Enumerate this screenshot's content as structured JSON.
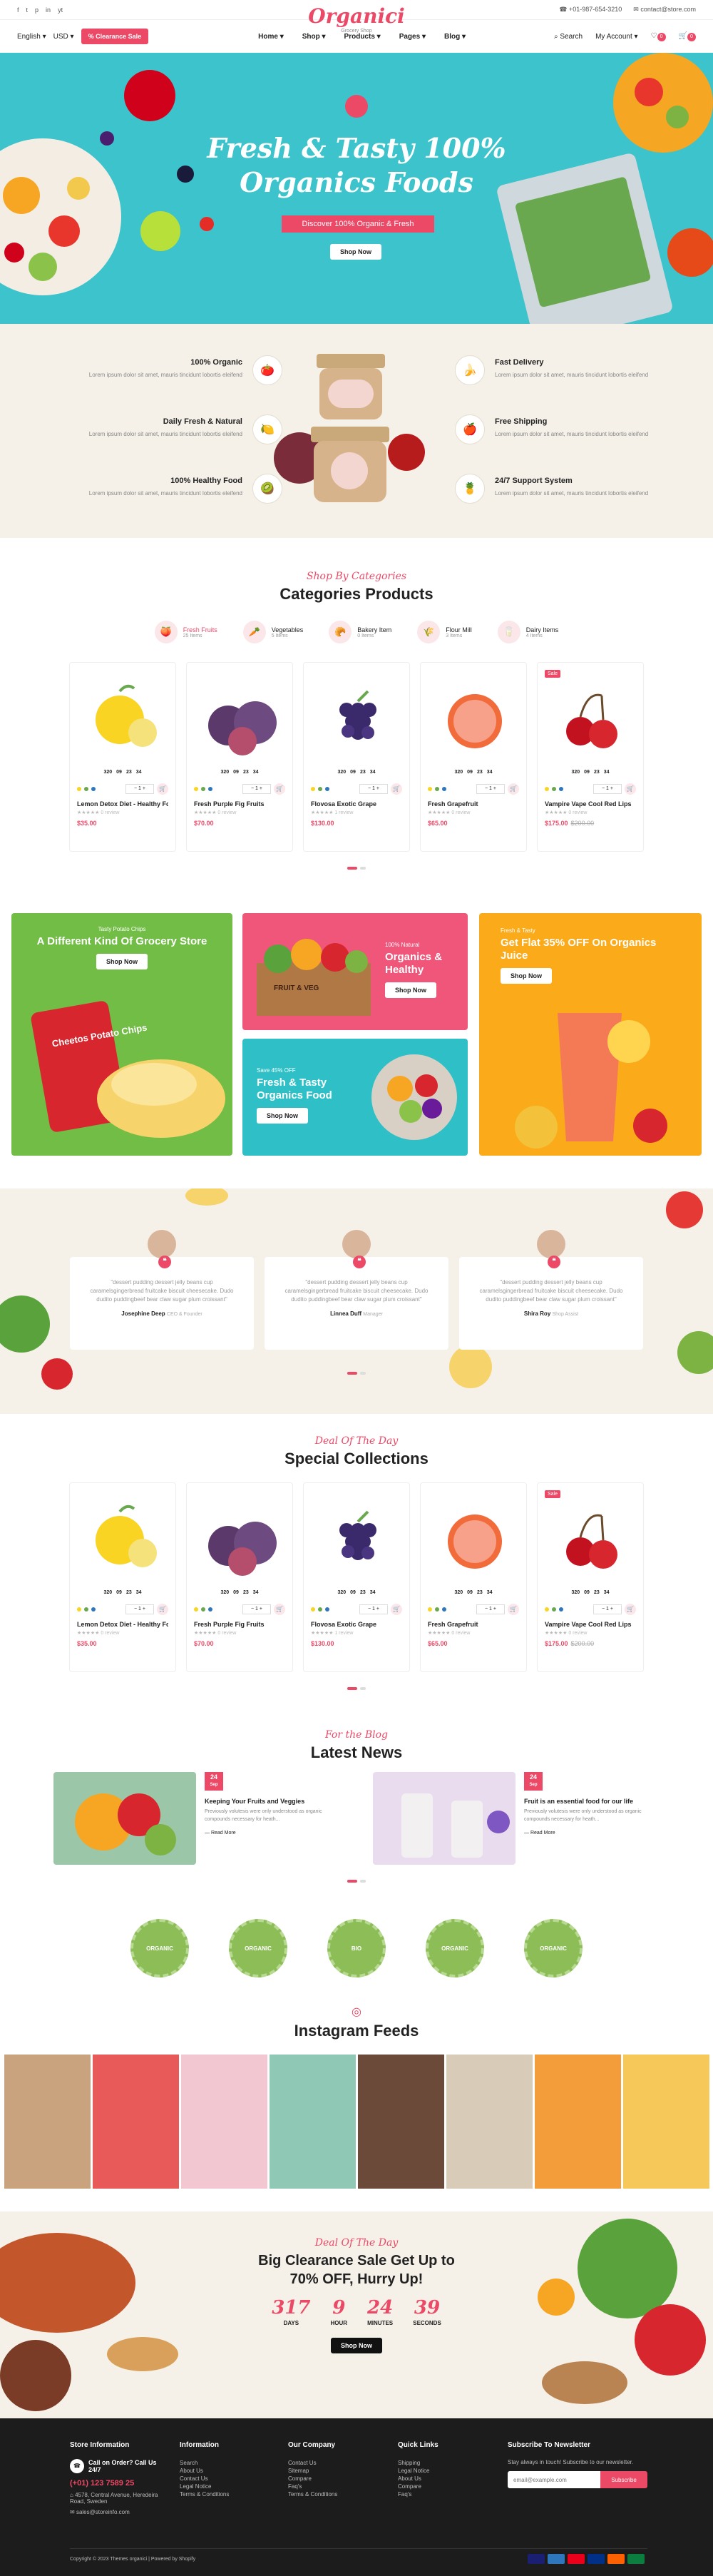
{
  "topbar": {
    "social": [
      "f",
      "t",
      "p",
      "in",
      "yt"
    ],
    "phone": "+01-987-654-3210",
    "email": "contact@store.com"
  },
  "logo": {
    "name": "Organici",
    "tagline": "Grocery Shop"
  },
  "nav": {
    "language": "English",
    "currency": "USD",
    "clearance": "Clearance Sale",
    "menu": [
      "Home",
      "Shop",
      "Products",
      "Pages",
      "Blog"
    ],
    "search": "Search",
    "account": "My Account",
    "wishlist_count": "0",
    "cart_count": "0"
  },
  "hero": {
    "title_line1": "Fresh & Tasty 100%",
    "title_line2": "Organics Foods",
    "subtitle": "Discover 100% Organic & Fresh",
    "button": "Shop Now"
  },
  "features": [
    {
      "title": "100% Organic",
      "text": "Lorem ipsum dolor sit amet, mauris tincidunt lobortis eleifend"
    },
    {
      "title": "Daily Fresh & Natural",
      "text": "Lorem ipsum dolor sit amet, mauris tincidunt lobortis eleifend"
    },
    {
      "title": "100% Healthy Food",
      "text": "Lorem ipsum dolor sit amet, mauris tincidunt lobortis eleifend"
    },
    {
      "title": "Fast Delivery",
      "text": "Lorem ipsum dolor sit amet, mauris tincidunt lobortis eleifend"
    },
    {
      "title": "Free Shipping",
      "text": "Lorem ipsum dolor sit amet, mauris tincidunt lobortis eleifend"
    },
    {
      "title": "24/7 Support System",
      "text": "Lorem ipsum dolor sit amet, mauris tincidunt lobortis eleifend"
    }
  ],
  "categories_section": {
    "kicker": "Shop By Categories",
    "title": "Categories Products",
    "categories": [
      {
        "name": "Fresh Fruits",
        "count": "25 Items",
        "icon": "fruit-icon"
      },
      {
        "name": "Vegetables",
        "count": "5 Items",
        "icon": "vegetable-icon"
      },
      {
        "name": "Bakery Item",
        "count": "0 Items",
        "icon": "bread-icon"
      },
      {
        "name": "Flour Mill",
        "count": "3 Items",
        "icon": "flour-icon"
      },
      {
        "name": "Dairy Items",
        "count": "4 Items",
        "icon": "dairy-icon"
      }
    ]
  },
  "products": [
    {
      "name": "Lemon Detox Diet - Healthy Fo...",
      "price": "$35.00",
      "old_price": "",
      "reviews": "0 review",
      "timer": [
        "320",
        "09",
        "23",
        "34"
      ],
      "sale": ""
    },
    {
      "name": "Fresh Purple Fig Fruits",
      "price": "$70.00",
      "old_price": "",
      "reviews": "0 review",
      "timer": [
        "320",
        "09",
        "23",
        "34"
      ],
      "sale": ""
    },
    {
      "name": "Flovosa Exotic Grape",
      "price": "$130.00",
      "old_price": "",
      "reviews": "1 review",
      "timer": [
        "320",
        "09",
        "23",
        "34"
      ],
      "sale": ""
    },
    {
      "name": "Fresh Grapefruit",
      "price": "$65.00",
      "old_price": "",
      "reviews": "0 review",
      "timer": [
        "320",
        "09",
        "23",
        "34"
      ],
      "sale": ""
    },
    {
      "name": "Vampire Vape Cool Red Lips",
      "price": "$175.00",
      "old_price": "$200.00",
      "reviews": "0 review",
      "timer": [
        "320",
        "09",
        "23",
        "34"
      ],
      "sale": "Sale"
    }
  ],
  "banners": {
    "chips": {
      "kicker": "Tasty Potato Chips",
      "title": "A Different Kind Of Grocery Store",
      "button": "Shop Now",
      "product": "Cheetos Potato Chips"
    },
    "healthy": {
      "kicker": "100% Natural",
      "title": "Organics & Healthy",
      "button": "Shop Now",
      "crate": "FRUIT & VEG"
    },
    "juice": {
      "kicker": "Fresh & Tasty",
      "title": "Get Flat 35% OFF On Organics Juice",
      "button": "Shop Now"
    },
    "tasty": {
      "kicker": "Save 45% OFF",
      "title": "Fresh & Tasty Organics Food",
      "button": "Shop Now"
    }
  },
  "testimonials": [
    {
      "text": "\"dessert pudding dessert jelly beans cup caramelsgingerbread fruitcake biscuit cheesecake. Dudo dudito puddingbeef bear claw sugar plum croissant\"",
      "name": "Josephine Deep",
      "role": "CEO & Founder"
    },
    {
      "text": "\"dessert pudding dessert jelly beans cup caramelsgingerbread fruitcake biscuit cheesecake. Dudo dudito puddingbeef bear claw sugar plum croissant\"",
      "name": "Linnea Duff",
      "role": "Manager"
    },
    {
      "text": "\"dessert pudding dessert jelly beans cup caramelsgingerbread fruitcake biscuit cheesecake. Dudo dudito puddingbeef bear claw sugar plum croissant\"",
      "name": "Shira Roy",
      "role": "Shop Assist"
    }
  ],
  "special": {
    "kicker": "Deal Of The Day",
    "title": "Special Collections"
  },
  "news": {
    "kicker": "For the Blog",
    "title": "Latest News",
    "posts": [
      {
        "day": "24",
        "month": "Sep",
        "title": "Keeping Your Fruits and Veggies",
        "text": "Previously volutesis were only understood as organic compounds necessary for heath...",
        "more": "Read More"
      },
      {
        "day": "24",
        "month": "Sep",
        "title": "Fruit is an essential food for our life",
        "text": "Previously volutesis were only understood as organic compounds necessary for heath...",
        "more": "Read More"
      }
    ]
  },
  "seals": [
    "ORGANIC",
    "ORGANIC",
    "BIO",
    "ORGANIC",
    "ORGANIC"
  ],
  "instagram": {
    "title": "Instagram Feeds"
  },
  "deal": {
    "kicker": "Deal Of The Day",
    "title_line1": "Big Clearance Sale Get Up to",
    "title_line2": "70% OFF, Hurry Up!",
    "countdown": [
      {
        "value": "317",
        "label": "DAYS"
      },
      {
        "value": "9",
        "label": "HOUR"
      },
      {
        "value": "24",
        "label": "MINUTES"
      },
      {
        "value": "39",
        "label": "SECONDS"
      }
    ],
    "button": "Shop Now"
  },
  "footer": {
    "store_info": {
      "title": "Store Information",
      "call_label": "Call on Order? Call Us 24/7",
      "phone": "(+01) 123 7589 25",
      "address": "4578, Central Avenue, Heredeira Road, Sweden",
      "email": "sales@storeinfo.com"
    },
    "information": {
      "title": "Information",
      "links": [
        "Search",
        "About Us",
        "Contact Us",
        "Legal Notice",
        "Terms & Conditions"
      ]
    },
    "company": {
      "title": "Our Company",
      "links": [
        "Contact Us",
        "Sitemap",
        "Compare",
        "Faq's",
        "Terms & Conditions"
      ]
    },
    "quick": {
      "title": "Quick Links",
      "links": [
        "Shipping",
        "Legal Notice",
        "About Us",
        "Compare",
        "Faq's"
      ]
    },
    "newsletter": {
      "title": "Subscribe To Newsletter",
      "text": "Stay always in touch! Subscribe to our newsletter.",
      "placeholder": "email@example.com",
      "button": "Subscribe"
    },
    "copyright": "Copyright © 2023 Themes organici | Powered by Shopify",
    "payments": [
      "Visa",
      "Amex",
      "Mastercard",
      "Paypal",
      "Discover",
      "Jcb"
    ]
  },
  "colors": {
    "accent": "#ec4967",
    "hero_bg": "#3dc3cb",
    "cream_bg": "#f5f1e8",
    "footer_bg": "#1c1c1c"
  }
}
